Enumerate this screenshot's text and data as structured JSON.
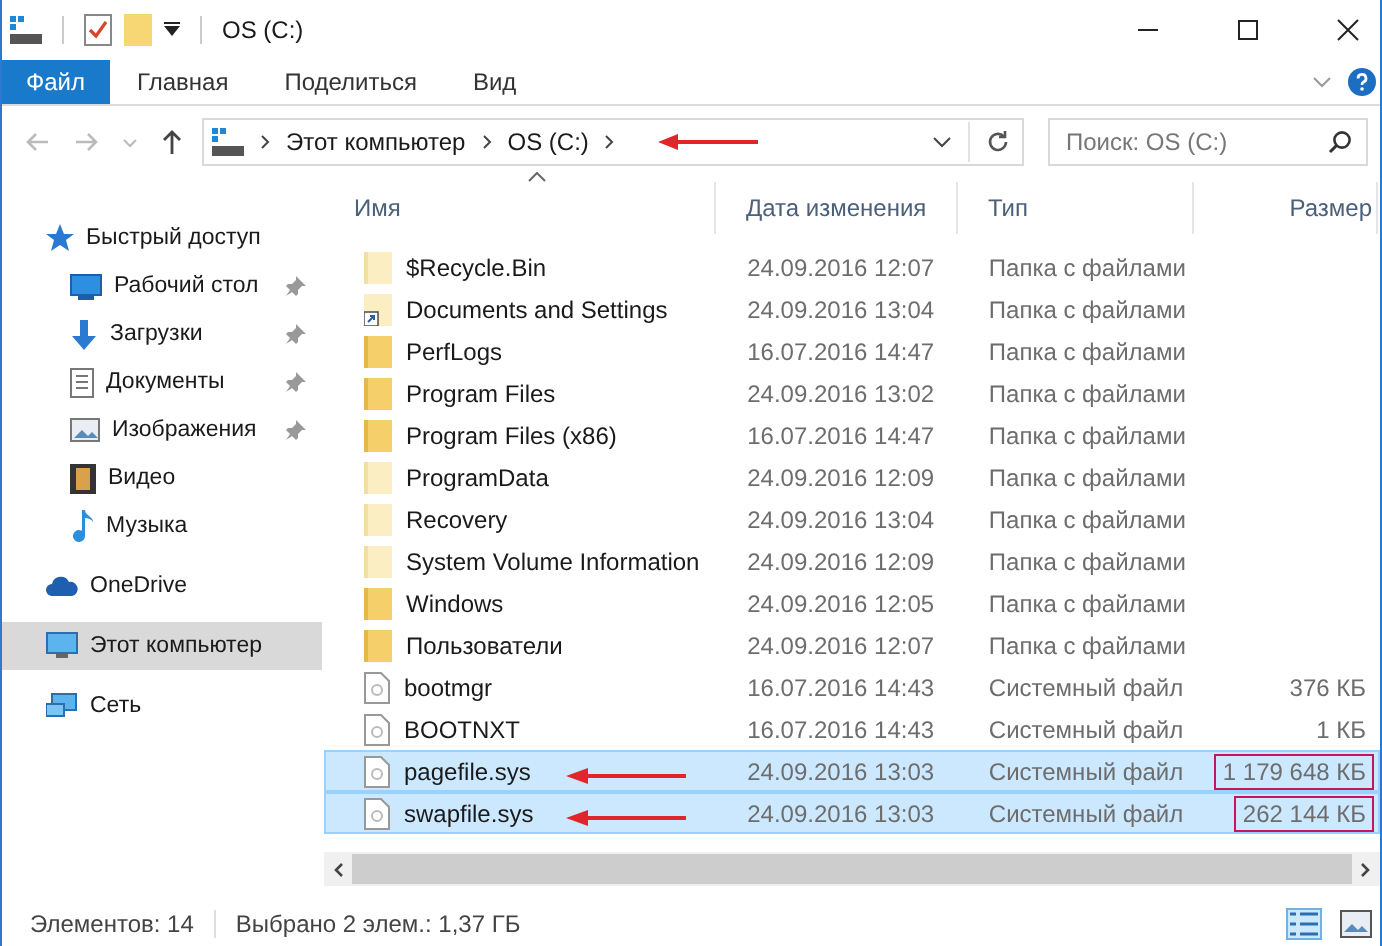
{
  "window": {
    "title": "OS (C:)"
  },
  "ribbon": {
    "tabs": [
      {
        "label": "Файл",
        "selected": true
      },
      {
        "label": "Главная",
        "selected": false
      },
      {
        "label": "Поделиться",
        "selected": false
      },
      {
        "label": "Вид",
        "selected": false
      }
    ]
  },
  "address": {
    "crumbs": [
      "Этот компьютер",
      "OS (C:)"
    ],
    "annotated": true
  },
  "search": {
    "placeholder": "Поиск: OS (C:)"
  },
  "sidebar": {
    "items": [
      {
        "label": "Быстрый доступ",
        "kind": "star",
        "selected": false,
        "children": [
          {
            "label": "Рабочий стол",
            "kind": "desktop",
            "pinned": true,
            "selected": false
          },
          {
            "label": "Загрузки",
            "kind": "download",
            "pinned": true,
            "selected": false
          },
          {
            "label": "Документы",
            "kind": "document",
            "pinned": true,
            "selected": false
          },
          {
            "label": "Изображения",
            "kind": "image",
            "pinned": true,
            "selected": false
          },
          {
            "label": "Видео",
            "kind": "video",
            "pinned": false,
            "selected": false
          },
          {
            "label": "Музыка",
            "kind": "music",
            "pinned": false,
            "selected": false
          }
        ]
      },
      {
        "label": "OneDrive",
        "kind": "cloud",
        "selected": false
      },
      {
        "label": "Этот компьютер",
        "kind": "computer",
        "selected": true
      },
      {
        "label": "Сеть",
        "kind": "network",
        "selected": false
      }
    ]
  },
  "table": {
    "columns": [
      "Имя",
      "Дата изменения",
      "Тип",
      "Размер"
    ],
    "rows": [
      {
        "kind": "hidden-folder",
        "name": "$Recycle.Bin",
        "date": "24.09.2016 12:07",
        "type": "Папка с файлами",
        "selected": false,
        "annotated": false
      },
      {
        "kind": "link",
        "name": "Documents and Settings",
        "date": "24.09.2016 13:04",
        "type": "Папка с файлами",
        "selected": false,
        "annotated": false
      },
      {
        "kind": "folder",
        "name": "PerfLogs",
        "date": "16.07.2016 14:47",
        "type": "Папка с файлами",
        "selected": false,
        "annotated": false
      },
      {
        "kind": "folder",
        "name": "Program Files",
        "date": "24.09.2016 13:02",
        "type": "Папка с файлами",
        "selected": false,
        "annotated": false
      },
      {
        "kind": "folder",
        "name": "Program Files (x86)",
        "date": "16.07.2016 14:47",
        "type": "Папка с файлами",
        "selected": false,
        "annotated": false
      },
      {
        "kind": "hidden-folder",
        "name": "ProgramData",
        "date": "24.09.2016 12:09",
        "type": "Папка с файлами",
        "selected": false,
        "annotated": false
      },
      {
        "kind": "hidden-folder",
        "name": "Recovery",
        "date": "24.09.2016 13:04",
        "type": "Папка с файлами",
        "selected": false,
        "annotated": false
      },
      {
        "kind": "hidden-folder",
        "name": "System Volume Information",
        "date": "24.09.2016 12:09",
        "type": "Папка с файлами",
        "selected": false,
        "annotated": false
      },
      {
        "kind": "folder",
        "name": "Windows",
        "date": "24.09.2016 12:05",
        "type": "Папка с файлами",
        "selected": false,
        "annotated": false
      },
      {
        "kind": "folder",
        "name": "Пользователи",
        "date": "24.09.2016 12:07",
        "type": "Папка с файлами",
        "selected": false,
        "annotated": false
      },
      {
        "kind": "file",
        "name": "bootmgr",
        "date": "16.07.2016 14:43",
        "type": "Системный файл",
        "size": "376 КБ",
        "selected": false,
        "annotated": false
      },
      {
        "kind": "file",
        "name": "BOOTNXT",
        "date": "16.07.2016 14:43",
        "type": "Системный файл",
        "size": "1 КБ",
        "selected": false,
        "annotated": false
      },
      {
        "kind": "file",
        "name": "pagefile.sys",
        "date": "24.09.2016 13:03",
        "type": "Системный файл",
        "size": "1 179 648 КБ",
        "selected": true,
        "annotated": true
      },
      {
        "kind": "file",
        "name": "swapfile.sys",
        "date": "24.09.2016 13:03",
        "type": "Системный файл",
        "size": "262 144 КБ",
        "selected": true,
        "annotated": true
      }
    ]
  },
  "status_bar": {
    "count": "Элементов: 14",
    "selection": "Выбрано 2 элем.: 1,37 ГБ"
  }
}
